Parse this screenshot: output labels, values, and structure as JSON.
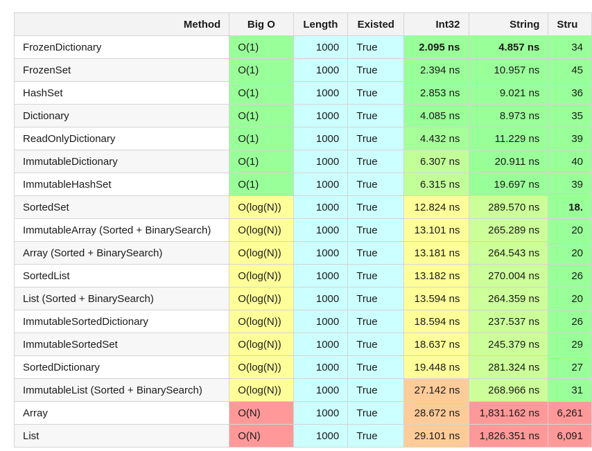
{
  "headers": {
    "method": "Method",
    "big_o": "Big O",
    "length": "Length",
    "existed": "Existed",
    "int32": "Int32",
    "string": "String",
    "struct": "Stru"
  },
  "rows": [
    {
      "method": "FrozenDictionary",
      "big_o": "O(1)",
      "length": "1000",
      "existed": "True",
      "int32": "2.095 ns",
      "string": "4.857 ns",
      "struct": "34",
      "bold": [
        "int32",
        "string"
      ],
      "colors": {
        "big_o": "#99ff99",
        "int32": "#99ff99",
        "string": "#99ff99",
        "struct": "#99ff99"
      }
    },
    {
      "method": "FrozenSet",
      "big_o": "O(1)",
      "length": "1000",
      "existed": "True",
      "int32": "2.394 ns",
      "string": "10.957 ns",
      "struct": "45",
      "bold": [],
      "colors": {
        "big_o": "#99ff99",
        "int32": "#99ff99",
        "string": "#99ff99",
        "struct": "#99ff99"
      }
    },
    {
      "method": "HashSet",
      "big_o": "O(1)",
      "length": "1000",
      "existed": "True",
      "int32": "2.853 ns",
      "string": "9.021 ns",
      "struct": "36",
      "bold": [],
      "colors": {
        "big_o": "#99ff99",
        "int32": "#99ff99",
        "string": "#99ff99",
        "struct": "#99ff99"
      }
    },
    {
      "method": "Dictionary",
      "big_o": "O(1)",
      "length": "1000",
      "existed": "True",
      "int32": "4.085 ns",
      "string": "8.973 ns",
      "struct": "35",
      "bold": [],
      "colors": {
        "big_o": "#99ff99",
        "int32": "#99ff99",
        "string": "#99ff99",
        "struct": "#99ff99"
      }
    },
    {
      "method": "ReadOnlyDictionary",
      "big_o": "O(1)",
      "length": "1000",
      "existed": "True",
      "int32": "4.432 ns",
      "string": "11.229 ns",
      "struct": "39",
      "bold": [],
      "colors": {
        "big_o": "#99ff99",
        "int32": "#a6ff99",
        "string": "#99ff99",
        "struct": "#99ff99"
      }
    },
    {
      "method": "ImmutableDictionary",
      "big_o": "O(1)",
      "length": "1000",
      "existed": "True",
      "int32": "6.307 ns",
      "string": "20.911 ns",
      "struct": "40",
      "bold": [],
      "colors": {
        "big_o": "#99ff99",
        "int32": "#c3ff99",
        "string": "#99ff99",
        "struct": "#99ff99"
      }
    },
    {
      "method": "ImmutableHashSet",
      "big_o": "O(1)",
      "length": "1000",
      "existed": "True",
      "int32": "6.315 ns",
      "string": "19.697 ns",
      "struct": "39",
      "bold": [],
      "colors": {
        "big_o": "#99ff99",
        "int32": "#c3ff99",
        "string": "#99ff99",
        "struct": "#99ff99"
      }
    },
    {
      "method": "SortedSet",
      "big_o": "O(log(N))",
      "length": "1000",
      "existed": "True",
      "int32": "12.824 ns",
      "string": "289.570 ns",
      "struct": "18.",
      "bold": [
        "struct"
      ],
      "colors": {
        "big_o": "#ffff99",
        "int32": "#ffff99",
        "string": "#ccff99",
        "struct": "#99ff99"
      }
    },
    {
      "method": "ImmutableArray (Sorted + BinarySearch)",
      "big_o": "O(log(N))",
      "length": "1000",
      "existed": "True",
      "int32": "13.101 ns",
      "string": "265.289 ns",
      "struct": "20",
      "bold": [],
      "colors": {
        "big_o": "#ffff99",
        "int32": "#ffff99",
        "string": "#ccff99",
        "struct": "#99ff99"
      }
    },
    {
      "method": "Array (Sorted + BinarySearch)",
      "big_o": "O(log(N))",
      "length": "1000",
      "existed": "True",
      "int32": "13.181 ns",
      "string": "264.543 ns",
      "struct": "20",
      "bold": [],
      "colors": {
        "big_o": "#ffff99",
        "int32": "#ffff99",
        "string": "#ccff99",
        "struct": "#99ff99"
      }
    },
    {
      "method": "SortedList",
      "big_o": "O(log(N))",
      "length": "1000",
      "existed": "True",
      "int32": "13.182 ns",
      "string": "270.004 ns",
      "struct": "26",
      "bold": [],
      "colors": {
        "big_o": "#ffff99",
        "int32": "#ffff99",
        "string": "#ccff99",
        "struct": "#99ff99"
      }
    },
    {
      "method": "List (Sorted + BinarySearch)",
      "big_o": "O(log(N))",
      "length": "1000",
      "existed": "True",
      "int32": "13.594 ns",
      "string": "264.359 ns",
      "struct": "20",
      "bold": [],
      "colors": {
        "big_o": "#ffff99",
        "int32": "#ffff99",
        "string": "#ccff99",
        "struct": "#99ff99"
      }
    },
    {
      "method": "ImmutableSortedDictionary",
      "big_o": "O(log(N))",
      "length": "1000",
      "existed": "True",
      "int32": "18.594 ns",
      "string": "237.537 ns",
      "struct": "26",
      "bold": [],
      "colors": {
        "big_o": "#ffff99",
        "int32": "#ffff99",
        "string": "#ccff99",
        "struct": "#99ff99"
      }
    },
    {
      "method": "ImmutableSortedSet",
      "big_o": "O(log(N))",
      "length": "1000",
      "existed": "True",
      "int32": "18.637 ns",
      "string": "245.379 ns",
      "struct": "29",
      "bold": [],
      "colors": {
        "big_o": "#ffff99",
        "int32": "#ffff99",
        "string": "#ccff99",
        "struct": "#99ff99"
      }
    },
    {
      "method": "SortedDictionary",
      "big_o": "O(log(N))",
      "length": "1000",
      "existed": "True",
      "int32": "19.448 ns",
      "string": "281.324 ns",
      "struct": "27",
      "bold": [],
      "colors": {
        "big_o": "#ffff99",
        "int32": "#ffff99",
        "string": "#ccff99",
        "struct": "#99ff99"
      }
    },
    {
      "method": "ImmutableList (Sorted + BinarySearch)",
      "big_o": "O(log(N))",
      "length": "1000",
      "existed": "True",
      "int32": "27.142 ns",
      "string": "268.966 ns",
      "struct": "31",
      "bold": [],
      "colors": {
        "big_o": "#ffff99",
        "int32": "#ffcc99",
        "string": "#ccff99",
        "struct": "#99ff99"
      }
    },
    {
      "method": "Array",
      "big_o": "O(N)",
      "length": "1000",
      "existed": "True",
      "int32": "28.672 ns",
      "string": "1,831.162 ns",
      "struct": "6,261",
      "bold": [],
      "colors": {
        "big_o": "#ff9999",
        "int32": "#ffcc99",
        "string": "#ff9999",
        "struct": "#ff9999"
      }
    },
    {
      "method": "List",
      "big_o": "O(N)",
      "length": "1000",
      "existed": "True",
      "int32": "29.101 ns",
      "string": "1,826.351 ns",
      "struct": "6,091",
      "bold": [],
      "colors": {
        "big_o": "#ff9999",
        "int32": "#ffcc99",
        "string": "#ff9999",
        "struct": "#ff9999"
      }
    }
  ],
  "colors": {
    "length_bg": "#ccffff",
    "existed_bg": "#ccffff",
    "header_bg": "#f3f3f3",
    "border": "#d4d4d4"
  }
}
